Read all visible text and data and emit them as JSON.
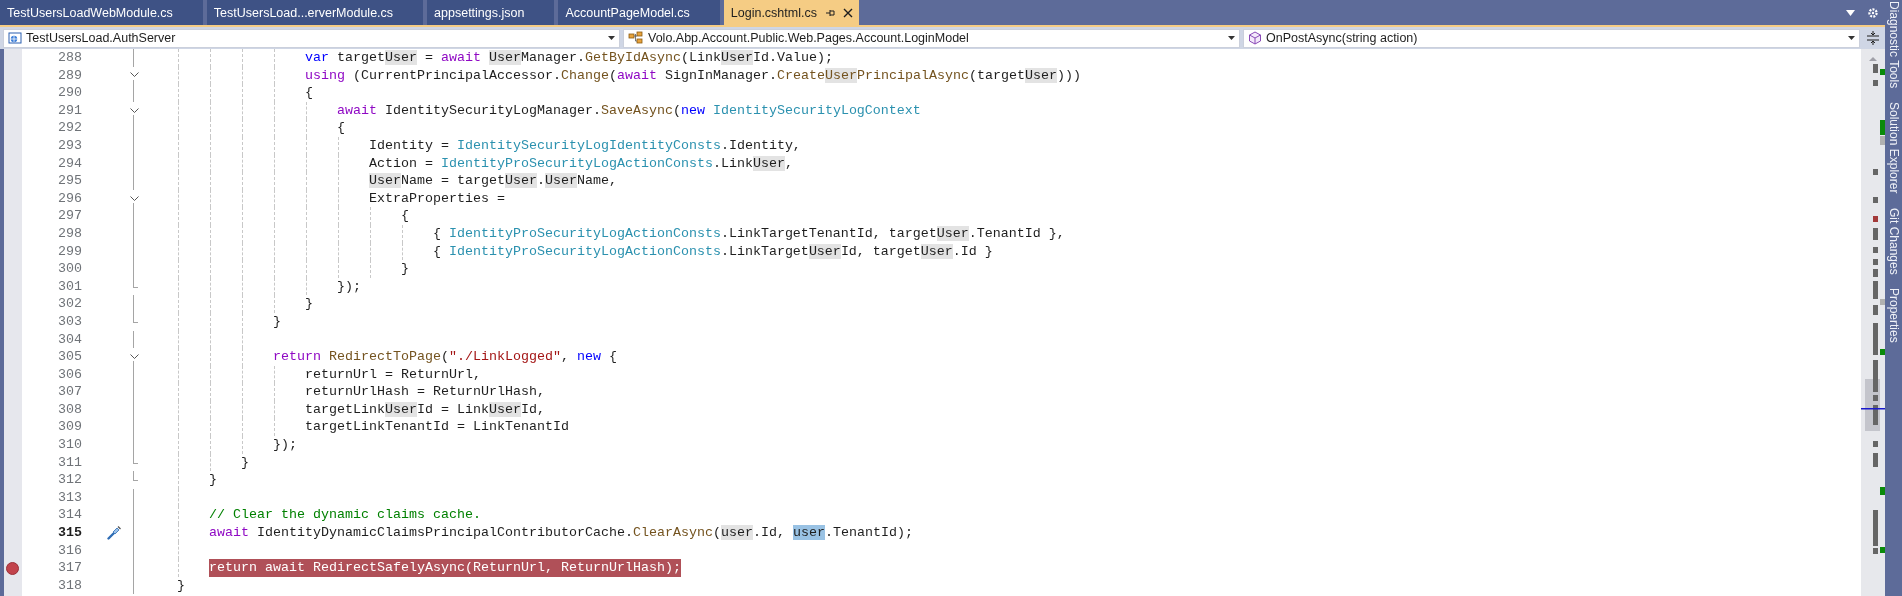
{
  "tabs": [
    {
      "label": "TestUsersLoadWebModule.cs",
      "selected": false
    },
    {
      "label": "TestUsersLoad...erverModule.cs",
      "selected": false
    },
    {
      "label": "appsettings.json",
      "selected": false
    },
    {
      "label": "AccountPageModel.cs",
      "selected": false
    },
    {
      "label": "Login.cshtml.cs",
      "selected": true
    }
  ],
  "navigation": [
    {
      "kind": "project",
      "text": "TestUsersLoad.AuthServer"
    },
    {
      "kind": "class",
      "text": "Volo.Abp.Account.Public.Web.Pages.Account.LoginModel"
    },
    {
      "kind": "member",
      "text": "OnPostAsync(string action)"
    }
  ],
  "side_tabs": [
    "Diagnostic Tools",
    "Solution Explorer",
    "Git Changes",
    "Properties"
  ],
  "lines": [
    {
      "number": "288",
      "tokens": [
        {
          "text": "                    var",
          "kind": "keyword"
        },
        {
          "text": " target",
          "kind": "plain"
        },
        {
          "text": "User",
          "kind": "plain",
          "highlighted": true
        },
        {
          "text": " = ",
          "kind": "plain"
        },
        {
          "text": "await ",
          "kind": "control"
        },
        {
          "text": "User",
          "kind": "plain",
          "highlighted": true
        },
        {
          "text": "Manager.",
          "kind": "plain"
        },
        {
          "text": "GetByIdAsync",
          "kind": "method"
        },
        {
          "text": "(Link",
          "kind": "plain"
        },
        {
          "text": "User",
          "kind": "plain",
          "highlighted": true
        },
        {
          "text": "Id.Value);",
          "kind": "plain"
        }
      ]
    },
    {
      "number": "289",
      "collapsible": true,
      "tokens": [
        {
          "text": "                    using",
          "kind": "control"
        },
        {
          "text": " (CurrentPrincipalAccessor.",
          "kind": "plain"
        },
        {
          "text": "Change",
          "kind": "method"
        },
        {
          "text": "(",
          "kind": "plain"
        },
        {
          "text": "await",
          "kind": "control"
        },
        {
          "text": " SignInManager.",
          "kind": "plain"
        },
        {
          "text": "Create",
          "kind": "method"
        },
        {
          "text": "User",
          "kind": "method",
          "highlighted": true
        },
        {
          "text": "PrincipalAsync",
          "kind": "method"
        },
        {
          "text": "(target",
          "kind": "plain"
        },
        {
          "text": "User",
          "kind": "plain",
          "highlighted": true
        },
        {
          "text": ")))",
          "kind": "plain"
        }
      ]
    },
    {
      "number": "290",
      "tokens": [
        {
          "text": "                    {",
          "kind": "plain"
        }
      ]
    },
    {
      "number": "291",
      "collapsible": true,
      "tokens": [
        {
          "text": "                        await",
          "kind": "control"
        },
        {
          "text": " IdentitySecurityLogManager.",
          "kind": "plain"
        },
        {
          "text": "SaveAsync",
          "kind": "method"
        },
        {
          "text": "(",
          "kind": "plain"
        },
        {
          "text": "new ",
          "kind": "keyword"
        },
        {
          "text": "IdentitySecurityLogContext",
          "kind": "type"
        }
      ]
    },
    {
      "number": "292",
      "tokens": [
        {
          "text": "                        {",
          "kind": "plain"
        }
      ]
    },
    {
      "number": "293",
      "tokens": [
        {
          "text": "                            Identity = ",
          "kind": "plain"
        },
        {
          "text": "IdentitySecurityLogIdentityConsts",
          "kind": "type"
        },
        {
          "text": ".Identity,",
          "kind": "plain"
        }
      ]
    },
    {
      "number": "294",
      "tokens": [
        {
          "text": "                            Action = ",
          "kind": "plain"
        },
        {
          "text": "IdentityProSecurityLogActionConsts",
          "kind": "type"
        },
        {
          "text": ".Link",
          "kind": "plain"
        },
        {
          "text": "User",
          "kind": "plain",
          "highlighted": true
        },
        {
          "text": ",",
          "kind": "plain"
        }
      ]
    },
    {
      "number": "295",
      "tokens": [
        {
          "text": "                            User",
          "kind": "plain",
          "highlighted": true
        },
        {
          "text": "Name = target",
          "kind": "plain"
        },
        {
          "text": "User",
          "kind": "plain",
          "highlighted": true
        },
        {
          "text": ".",
          "kind": "plain"
        },
        {
          "text": "User",
          "kind": "plain",
          "highlighted": true
        },
        {
          "text": "Name,",
          "kind": "plain"
        }
      ]
    },
    {
      "number": "296",
      "collapsible": true,
      "tokens": [
        {
          "text": "                            ExtraProperties =",
          "kind": "plain"
        }
      ]
    },
    {
      "number": "297",
      "tokens": [
        {
          "text": "                                {",
          "kind": "plain"
        }
      ]
    },
    {
      "number": "298",
      "tokens": [
        {
          "text": "                                    { ",
          "kind": "plain"
        },
        {
          "text": "IdentityProSecurityLogActionConsts",
          "kind": "type"
        },
        {
          "text": ".LinkTargetTenantId, target",
          "kind": "plain"
        },
        {
          "text": "User",
          "kind": "plain",
          "highlighted": true
        },
        {
          "text": ".TenantId },",
          "kind": "plain"
        }
      ]
    },
    {
      "number": "299",
      "tokens": [
        {
          "text": "                                    { ",
          "kind": "plain"
        },
        {
          "text": "IdentityProSecurityLogActionConsts",
          "kind": "type"
        },
        {
          "text": ".LinkTarget",
          "kind": "plain"
        },
        {
          "text": "User",
          "kind": "plain",
          "highlighted": true
        },
        {
          "text": "Id, target",
          "kind": "plain"
        },
        {
          "text": "User",
          "kind": "plain",
          "highlighted": true
        },
        {
          "text": ".Id }",
          "kind": "plain"
        }
      ]
    },
    {
      "number": "300",
      "tokens": [
        {
          "text": "                                }",
          "kind": "plain"
        }
      ]
    },
    {
      "number": "301",
      "block_end": true,
      "tokens": [
        {
          "text": "                        });",
          "kind": "plain"
        }
      ]
    },
    {
      "number": "302",
      "tokens": [
        {
          "text": "                    }",
          "kind": "plain"
        }
      ]
    },
    {
      "number": "303",
      "block_end": true,
      "tokens": [
        {
          "text": "                }",
          "kind": "plain"
        }
      ]
    },
    {
      "number": "304"
    },
    {
      "number": "305",
      "collapsible": true,
      "tokens": [
        {
          "text": "                return ",
          "kind": "control"
        },
        {
          "text": "RedirectToPage",
          "kind": "method"
        },
        {
          "text": "(",
          "kind": "plain"
        },
        {
          "text": "\"./LinkLogged\"",
          "kind": "string"
        },
        {
          "text": ", ",
          "kind": "plain"
        },
        {
          "text": "new",
          "kind": "keyword"
        },
        {
          "text": " {",
          "kind": "plain"
        }
      ]
    },
    {
      "number": "306",
      "tokens": [
        {
          "text": "                    returnUrl = ReturnUrl,",
          "kind": "plain"
        }
      ]
    },
    {
      "number": "307",
      "tokens": [
        {
          "text": "                    returnUrlHash = ReturnUrlHash,",
          "kind": "plain"
        }
      ]
    },
    {
      "number": "308",
      "tokens": [
        {
          "text": "                    targetLink",
          "kind": "plain"
        },
        {
          "text": "User",
          "kind": "plain",
          "highlighted": true
        },
        {
          "text": "Id = Link",
          "kind": "plain"
        },
        {
          "text": "User",
          "kind": "plain",
          "highlighted": true
        },
        {
          "text": "Id,",
          "kind": "plain"
        }
      ]
    },
    {
      "number": "309",
      "tokens": [
        {
          "text": "                    targetLinkTenantId = LinkTenantId",
          "kind": "plain"
        }
      ]
    },
    {
      "number": "310",
      "tokens": [
        {
          "text": "                });",
          "kind": "plain"
        }
      ]
    },
    {
      "number": "311",
      "block_end": true,
      "tokens": [
        {
          "text": "            }",
          "kind": "plain"
        }
      ]
    },
    {
      "number": "312",
      "block_end": true,
      "tokens": [
        {
          "text": "        }",
          "kind": "plain"
        }
      ]
    },
    {
      "number": "313"
    },
    {
      "number": "314",
      "tokens": [
        {
          "text": "        // Clear the dynamic claims cache.",
          "kind": "comment"
        }
      ]
    },
    {
      "number": "315",
      "current": true,
      "quick_action": true,
      "tokens": [
        {
          "text": "        await",
          "kind": "control"
        },
        {
          "text": " IdentityDynamicClaimsPrincipalContributorCache.",
          "kind": "plain"
        },
        {
          "text": "ClearAsync",
          "kind": "method"
        },
        {
          "text": "(",
          "kind": "plain"
        },
        {
          "text": "user",
          "kind": "plain",
          "highlighted": true
        },
        {
          "text": ".Id, ",
          "kind": "plain"
        },
        {
          "text": "user",
          "kind": "plain",
          "selected": true
        },
        {
          "text": ".TenantId);",
          "kind": "plain"
        }
      ]
    },
    {
      "number": "316"
    },
    {
      "number": "317",
      "breakpoint": true,
      "tokens": [
        {
          "text": "        return await RedirectSafelyAsync(ReturnUrl, ReturnUrlHash);"
        }
      ]
    },
    {
      "number": "318",
      "tokens": [
        {
          "text": "    }",
          "kind": "plain"
        }
      ]
    }
  ]
}
